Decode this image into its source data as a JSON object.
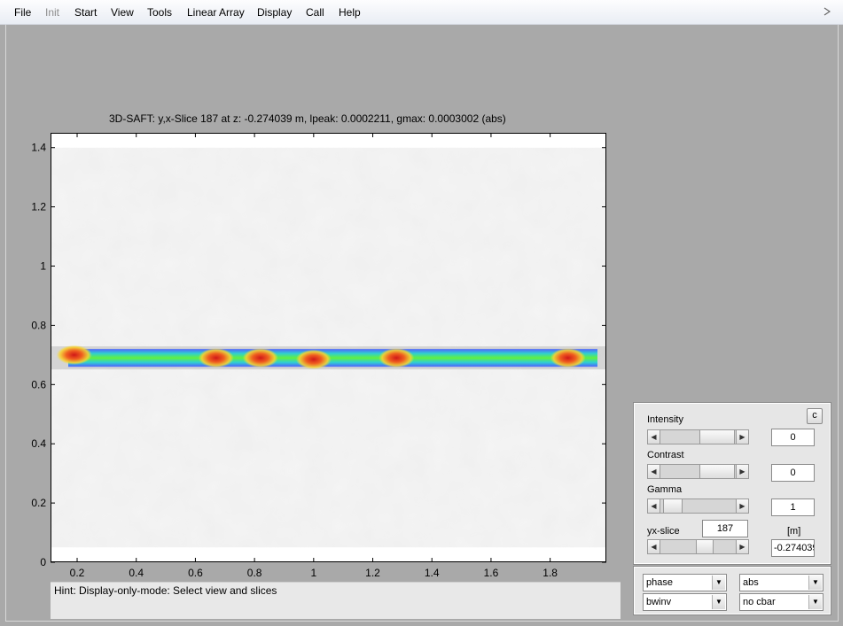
{
  "menu": {
    "items": [
      {
        "label": "File",
        "enabled": true
      },
      {
        "label": "Init",
        "enabled": false
      },
      {
        "label": "Start",
        "enabled": true
      },
      {
        "label": "View",
        "enabled": true
      },
      {
        "label": "Tools",
        "enabled": true
      },
      {
        "label": "Linear Array",
        "enabled": true
      },
      {
        "label": "Display",
        "enabled": true
      },
      {
        "label": "Call",
        "enabled": true
      },
      {
        "label": "Help",
        "enabled": true
      }
    ]
  },
  "plot": {
    "title": "3D-SAFT: y,x-Slice 187 at z: -0.274039 m, lpeak: 0.0002211, gmax: 0.0003002 (abs)"
  },
  "chart_data": {
    "type": "heatmap",
    "title": "3D-SAFT: y,x-Slice 187 at z: -0.274039 m, lpeak: 0.0002211, gmax: 0.0003002 (abs)",
    "xlabel": "",
    "ylabel": "",
    "xlim": [
      0.11,
      1.99
    ],
    "ylim": [
      0,
      1.45
    ],
    "x_ticks": [
      0.2,
      0.4,
      0.6,
      0.8,
      1,
      1.2,
      1.4,
      1.6,
      1.8
    ],
    "x_tick_labels": [
      "0.2",
      "0.4",
      "0.6",
      "0.8",
      "1",
      "1.2",
      "1.4",
      "1.6",
      "1.8"
    ],
    "y_ticks": [
      0,
      0.2,
      0.4,
      0.6,
      0.8,
      1,
      1.2,
      1.4
    ],
    "y_tick_labels": [
      "0",
      "0.2",
      "0.4",
      "0.6",
      "0.8",
      "1",
      "1.2",
      "1.4"
    ],
    "image_extent": {
      "x": [
        0.11,
        1.99
      ],
      "y": [
        0.05,
        1.4
      ]
    },
    "band": {
      "x": [
        0.17,
        1.96
      ],
      "y_center": 0.69,
      "y_half_width": 0.03
    },
    "hotspots": [
      {
        "x": 0.19,
        "y": 0.7
      },
      {
        "x": 0.67,
        "y": 0.69
      },
      {
        "x": 0.82,
        "y": 0.69
      },
      {
        "x": 1.0,
        "y": 0.685
      },
      {
        "x": 1.28,
        "y": 0.69
      },
      {
        "x": 1.86,
        "y": 0.69
      }
    ],
    "colors": {
      "background": "#f0f0f0",
      "low": "#3040ff",
      "mid": "#30e060",
      "high": "#ffe030",
      "peak": "#e02020"
    }
  },
  "hint": {
    "text": "Hint: Display-only-mode: Select view and slices"
  },
  "controls": {
    "c_button": "c",
    "intensity": {
      "label": "Intensity",
      "value": "0"
    },
    "contrast": {
      "label": "Contrast",
      "value": "0"
    },
    "gamma": {
      "label": "Gamma",
      "value": "1"
    },
    "yx_slice": {
      "label": "yx-slice",
      "value": "187"
    },
    "unit_label": "[m]",
    "z_value": "-0.274039"
  },
  "selectors": {
    "mode": "phase",
    "value_type": "abs",
    "colormap": "bwinv",
    "colorbar": "no cbar"
  }
}
